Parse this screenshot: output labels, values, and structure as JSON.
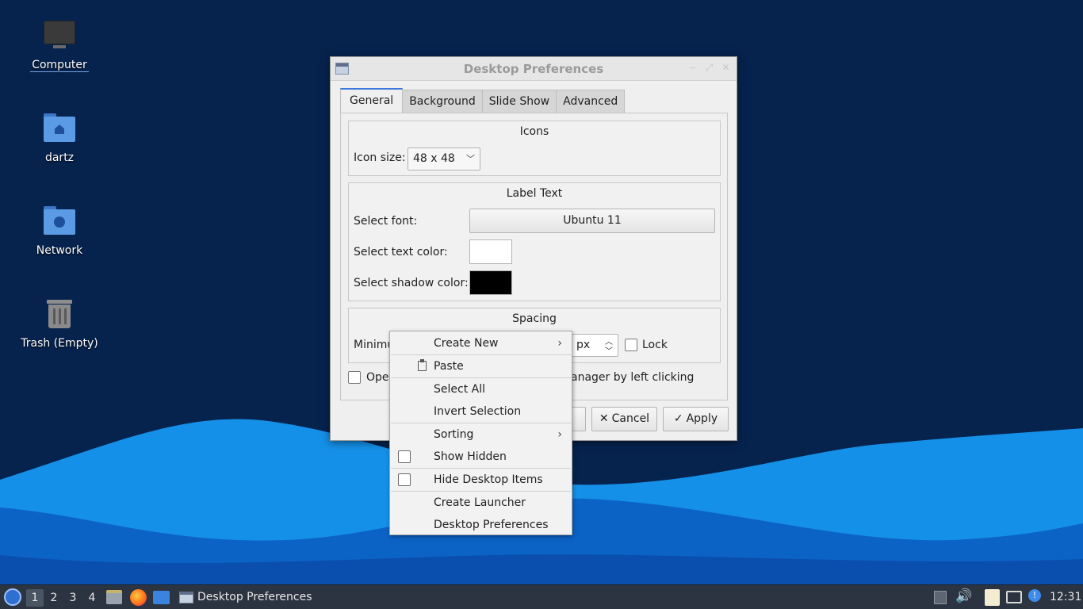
{
  "desktop": {
    "icons": [
      {
        "name": "computer-icon",
        "label": "Computer"
      },
      {
        "name": "home-folder-icon",
        "label": "dartz"
      },
      {
        "name": "network-folder-icon",
        "label": "Network"
      },
      {
        "name": "trash-icon",
        "label": "Trash (Empty)"
      }
    ]
  },
  "dialog": {
    "title": "Desktop Preferences",
    "tabs": [
      "General",
      "Background",
      "Slide Show",
      "Advanced"
    ],
    "active_tab": "General",
    "icons_group": {
      "title": "Icons",
      "icon_size_label": "Icon size:",
      "icon_size_value": "48 x 48"
    },
    "label_group": {
      "title": "Label Text",
      "font_label": "Select font:",
      "font_value": "Ubuntu 11",
      "text_color_label": "Select text color:",
      "text_color": "#ffffff",
      "shadow_color_label": "Select shadow color:",
      "shadow_color": "#000000"
    },
    "spacing_group": {
      "title": "Spacing",
      "min_label": "Minimu",
      "unit": "px",
      "lock_label": "Lock"
    },
    "open_label_left": "Ope",
    "open_label_right": "anager by left clicking",
    "cancel_label": "Cancel",
    "apply_label": "Apply"
  },
  "context_menu": {
    "items": [
      {
        "label": "Create New",
        "submenu": true
      },
      {
        "label": "Paste",
        "icon": "clipboard-icon"
      },
      {
        "label": "Select All"
      },
      {
        "label": "Invert Selection"
      },
      {
        "label": "Sorting",
        "submenu": true
      },
      {
        "label": "Show Hidden",
        "checkbox": true
      },
      {
        "label": "Hide Desktop Items",
        "checkbox": true
      },
      {
        "label": "Create Launcher"
      },
      {
        "label": "Desktop Preferences"
      }
    ]
  },
  "taskbar": {
    "workspaces": [
      "1",
      "2",
      "3",
      "4"
    ],
    "current_workspace": "1",
    "window_title": "Desktop Preferences",
    "clock": "12:31"
  },
  "colors": {
    "desktop_bg": "#06234e",
    "wave_light": "#1e8fe6",
    "wave_dark": "#0a5fc0",
    "accent": "#3b7ad9"
  }
}
